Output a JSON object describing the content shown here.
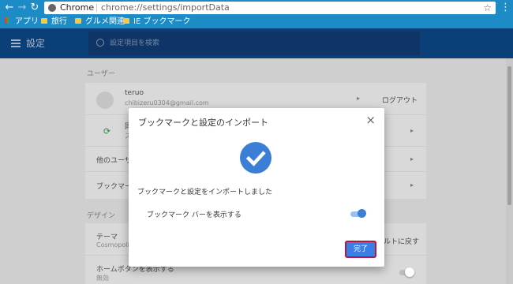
{
  "browser": {
    "site_label": "Chrome",
    "url": "chrome://settings/importData"
  },
  "bookmarks_bar": [
    {
      "label": "アプリ",
      "icon": "apps-grid-icon"
    },
    {
      "label": "旅行",
      "icon": "folder-icon"
    },
    {
      "label": "グルメ関連",
      "icon": "folder-icon"
    },
    {
      "label": "IE ブックマーク",
      "icon": "folder-icon"
    }
  ],
  "header": {
    "title": "設定",
    "search_placeholder": "設定項目を検索"
  },
  "settings": {
    "user_section_label": "ユーザー",
    "profile_name": "teruo",
    "profile_email": "chibizeru0304@gmail.com",
    "logout_label": "ログアウト",
    "sync_text": "同",
    "sync_sub": "ス",
    "other_users": "他のユーザ",
    "bookmarks_row": "ブックマー",
    "design_section_label": "デザイン",
    "theme_label": "テーマ",
    "theme_sub": "Cosmopoli",
    "reset_text": "ルトに戻す",
    "home_button_label": "ホームボタンを表示する",
    "home_button_sub": "無効"
  },
  "dialog": {
    "title": "ブックマークと設定のインポート",
    "message": "ブックマークと設定をインポートしました",
    "option_label": "ブックマーク バーを表示する",
    "option_enabled": true,
    "done_label": "完了"
  },
  "colors": {
    "chrome_blue": "#1d8cc6",
    "settings_header": "#0b3f78",
    "accent": "#3a7ed6",
    "done_outline": "#b4183f"
  }
}
